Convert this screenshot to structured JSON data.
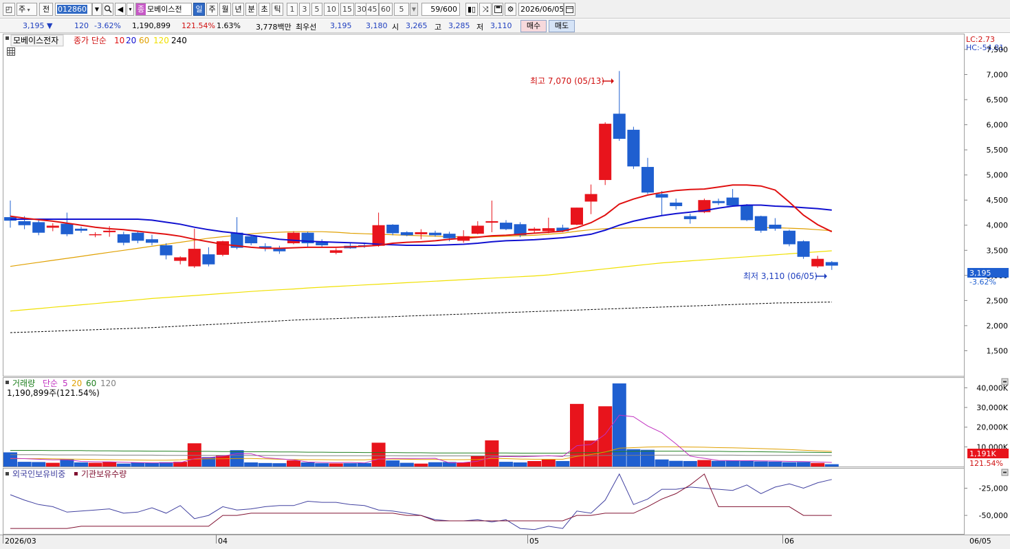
{
  "toolbar": {
    "type_label": "주",
    "type_all": "전",
    "stock_code": "012860",
    "stock_name": "모베이스전",
    "name_badge": "종",
    "periods": [
      "일",
      "주",
      "월",
      "년",
      "분",
      "초",
      "틱"
    ],
    "selected_period": "일",
    "intervals": [
      "1",
      "3",
      "5",
      "10",
      "15",
      "30",
      "45",
      "60"
    ],
    "custom_interval": "5",
    "count": "59/600",
    "date": "2026/06/05"
  },
  "quote": {
    "price": "3,195",
    "arrow": "▼",
    "change": "120",
    "change_pct": "-3.62%",
    "volume": "1,190,899",
    "volume_ratio": "121.54%",
    "turnover_pct": "1.63%",
    "amount": "3,778백만",
    "best_label": "최우선",
    "best_ask": "3,195",
    "best_bid": "3,180",
    "open_label": "시",
    "open": "3,265",
    "high_label": "고",
    "high": "3,285",
    "low_label": "저",
    "low": "3,110",
    "buy_label": "매수",
    "sell_label": "매도"
  },
  "price_panel": {
    "stock_tab": "모베이스전자",
    "ma_label": "종가 단순",
    "ma_periods": [
      {
        "label": "10",
        "color": "#e01010"
      },
      {
        "label": "20",
        "color": "#1010d0"
      },
      {
        "label": "60",
        "color": "#e0a000"
      },
      {
        "label": "120",
        "color": "#f0e000"
      },
      {
        "label": "240",
        "color": "#000000"
      }
    ],
    "lc": "LC:2.73",
    "hc": "HC:-54.81",
    "high_annotation": "최고 7,070 (05/13)",
    "low_annotation": "최저 3,110 (06/05)",
    "current_price_tag": "3,195",
    "current_pct_tag": "-3.62%",
    "up_color": "#e8141c",
    "down_color": "#1f5fd0"
  },
  "volume_panel": {
    "title": "거래량",
    "ma_label": "단순",
    "ma_periods": [
      {
        "label": "5",
        "color": "#c030c0"
      },
      {
        "label": "20",
        "color": "#e0a000"
      },
      {
        "label": "60",
        "color": "#208020"
      },
      {
        "label": "120",
        "color": "#808080"
      }
    ],
    "summary": "1,190,899주(121.54%)",
    "current_tag": "1,191K",
    "current_pct_tag": "121.54%"
  },
  "holding_panel": {
    "foreign_label": "외국인보유비중",
    "institution_label": "기관보유수량"
  },
  "x_axis": {
    "labels": [
      "2026/03",
      "04",
      "05",
      "06"
    ],
    "current_date_label": "06/05"
  },
  "chart_data": [
    {
      "type": "candlestick",
      "ylim": [
        1000,
        7800
      ],
      "y_ticks": [
        "7,500",
        "7,000",
        "6,500",
        "6,000",
        "5,500",
        "5,000",
        "4,500",
        "4,000",
        "3,500",
        "3,000",
        "2,500",
        "2,000",
        "1,500"
      ],
      "y_tick_values": [
        7500,
        7000,
        6500,
        6000,
        5500,
        5000,
        4500,
        4000,
        3500,
        3000,
        2500,
        2000,
        1500
      ],
      "candles": [
        [
          4160,
          4490,
          3950,
          4090
        ],
        [
          4080,
          4180,
          3920,
          4000
        ],
        [
          4060,
          4110,
          3800,
          3850
        ],
        [
          3950,
          4040,
          3880,
          3990
        ],
        [
          4030,
          4250,
          3780,
          3820
        ],
        [
          3930,
          3970,
          3850,
          3890
        ],
        [
          3800,
          3860,
          3760,
          3820
        ],
        [
          3860,
          3980,
          3770,
          3890
        ],
        [
          3820,
          3870,
          3600,
          3650
        ],
        [
          3850,
          3880,
          3640,
          3690
        ],
        [
          3720,
          3810,
          3600,
          3650
        ],
        [
          3600,
          3640,
          3320,
          3400
        ],
        [
          3290,
          3380,
          3220,
          3360
        ],
        [
          3180,
          3930,
          3150,
          3530
        ],
        [
          3420,
          3560,
          3180,
          3220
        ],
        [
          3410,
          3690,
          3380,
          3680
        ],
        [
          3850,
          4160,
          3520,
          3550
        ],
        [
          3780,
          3810,
          3600,
          3640
        ],
        [
          3580,
          3640,
          3480,
          3540
        ],
        [
          3550,
          3590,
          3430,
          3480
        ],
        [
          3640,
          3880,
          3620,
          3850
        ],
        [
          3850,
          3870,
          3560,
          3640
        ],
        [
          3660,
          3720,
          3560,
          3600
        ],
        [
          3450,
          3540,
          3420,
          3500
        ],
        [
          3590,
          3640,
          3530,
          3540
        ],
        [
          3600,
          3640,
          3550,
          3580
        ],
        [
          3590,
          4250,
          3570,
          4000
        ],
        [
          4010,
          4020,
          3800,
          3840
        ],
        [
          3860,
          3880,
          3780,
          3800
        ],
        [
          3820,
          3920,
          3720,
          3860
        ],
        [
          3850,
          3890,
          3770,
          3800
        ],
        [
          3830,
          3870,
          3680,
          3740
        ],
        [
          3690,
          3900,
          3650,
          3780
        ],
        [
          3830,
          4080,
          3820,
          3990
        ],
        [
          4050,
          4490,
          3860,
          4080
        ],
        [
          4050,
          4100,
          3900,
          3920
        ],
        [
          4020,
          4060,
          3760,
          3800
        ],
        [
          3890,
          3960,
          3840,
          3930
        ],
        [
          3880,
          4150,
          3840,
          3940
        ],
        [
          3950,
          4010,
          3860,
          3880
        ],
        [
          4010,
          4350,
          4000,
          4350
        ],
        [
          4470,
          4810,
          4220,
          4620
        ],
        [
          4900,
          6050,
          4800,
          6020
        ],
        [
          6220,
          7070,
          5680,
          5720
        ],
        [
          5900,
          5960,
          5120,
          5170
        ],
        [
          5160,
          5340,
          4620,
          4650
        ],
        [
          4620,
          4680,
          4200,
          4550
        ],
        [
          4450,
          4530,
          4310,
          4380
        ],
        [
          4180,
          4230,
          4030,
          4120
        ],
        [
          4260,
          4530,
          4240,
          4500
        ],
        [
          4480,
          4530,
          4400,
          4440
        ],
        [
          4550,
          4720,
          4380,
          4390
        ],
        [
          4390,
          4420,
          4080,
          4100
        ],
        [
          4180,
          4190,
          3850,
          3890
        ],
        [
          4010,
          4140,
          3890,
          3930
        ],
        [
          3890,
          3910,
          3580,
          3620
        ],
        [
          3680,
          3700,
          3330,
          3370
        ],
        [
          3180,
          3390,
          3150,
          3330
        ],
        [
          3265,
          3285,
          3110,
          3195
        ]
      ],
      "ma10": [
        4180,
        4140,
        4110,
        4080,
        4040,
        4000,
        3960,
        3930,
        3910,
        3880,
        3850,
        3820,
        3780,
        3720,
        3670,
        3620,
        3590,
        3560,
        3540,
        3540,
        3550,
        3560,
        3560,
        3560,
        3570,
        3580,
        3600,
        3640,
        3660,
        3670,
        3690,
        3720,
        3740,
        3760,
        3790,
        3800,
        3820,
        3840,
        3860,
        3880,
        3950,
        4050,
        4200,
        4420,
        4520,
        4600,
        4650,
        4690,
        4710,
        4720,
        4760,
        4800,
        4800,
        4780,
        4700,
        4460,
        4200,
        4010,
        3870
      ],
      "ma20": [
        4120,
        4120,
        4120,
        4120,
        4120,
        4120,
        4120,
        4120,
        4120,
        4120,
        4100,
        4060,
        4020,
        3960,
        3910,
        3870,
        3840,
        3800,
        3760,
        3720,
        3700,
        3680,
        3670,
        3660,
        3650,
        3640,
        3620,
        3610,
        3600,
        3600,
        3600,
        3610,
        3620,
        3640,
        3670,
        3690,
        3700,
        3710,
        3730,
        3750,
        3780,
        3820,
        3900,
        4000,
        4080,
        4140,
        4190,
        4230,
        4260,
        4290,
        4340,
        4380,
        4400,
        4400,
        4380,
        4370,
        4350,
        4330,
        4300
      ],
      "ma60": [
        3180,
        3220,
        3260,
        3300,
        3340,
        3380,
        3420,
        3460,
        3500,
        3540,
        3580,
        3620,
        3660,
        3700,
        3740,
        3770,
        3800,
        3830,
        3850,
        3860,
        3870,
        3870,
        3870,
        3860,
        3840,
        3830,
        3820,
        3810,
        3800,
        3790,
        3780,
        3770,
        3770,
        3770,
        3770,
        3780,
        3790,
        3800,
        3820,
        3840,
        3880,
        3910,
        3930,
        3940,
        3950,
        3950,
        3950,
        3950,
        3950,
        3950,
        3950,
        3950,
        3950,
        3950,
        3950,
        3940,
        3930,
        3910,
        3890
      ],
      "ma120": [
        2290,
        2315,
        2340,
        2365,
        2390,
        2415,
        2440,
        2465,
        2490,
        2515,
        2540,
        2560,
        2580,
        2600,
        2620,
        2640,
        2660,
        2680,
        2700,
        2715,
        2730,
        2750,
        2765,
        2780,
        2795,
        2810,
        2825,
        2840,
        2855,
        2870,
        2885,
        2900,
        2915,
        2930,
        2945,
        2960,
        2975,
        2990,
        3010,
        3040,
        3070,
        3100,
        3130,
        3160,
        3190,
        3220,
        3250,
        3270,
        3290,
        3310,
        3330,
        3350,
        3370,
        3390,
        3410,
        3430,
        3450,
        3470,
        3490
      ],
      "ma240": [
        1860,
        1870,
        1880,
        1890,
        1900,
        1910,
        1920,
        1930,
        1940,
        1950,
        1960,
        1975,
        1990,
        2005,
        2020,
        2035,
        2050,
        2065,
        2080,
        2095,
        2110,
        2120,
        2130,
        2140,
        2150,
        2160,
        2170,
        2180,
        2190,
        2200,
        2210,
        2220,
        2230,
        2240,
        2250,
        2260,
        2270,
        2280,
        2290,
        2300,
        2310,
        2320,
        2330,
        2340,
        2350,
        2360,
        2370,
        2380,
        2390,
        2400,
        2410,
        2420,
        2430,
        2440,
        2450,
        2455,
        2460,
        2465,
        2470
      ]
    },
    {
      "type": "bar",
      "series_name": "거래량",
      "ylim": [
        0,
        45000
      ],
      "y_ticks": [
        "40,000K",
        "30,000K",
        "20,000K",
        "10,000K"
      ],
      "y_tick_values": [
        40000,
        30000,
        20000,
        10000
      ],
      "volumes": [
        7200,
        2400,
        2300,
        1900,
        3700,
        2100,
        1900,
        2300,
        1500,
        2100,
        1900,
        2200,
        2400,
        11800,
        4800,
        5600,
        8300,
        2100,
        1800,
        1700,
        3100,
        2100,
        1700,
        1600,
        1700,
        1800,
        12100,
        3100,
        1900,
        1500,
        2200,
        2300,
        2100,
        5500,
        13300,
        2400,
        2100,
        2800,
        3600,
        2800,
        31800,
        13200,
        30600,
        42200,
        8800,
        8500,
        3600,
        2900,
        2800,
        3300,
        2900,
        3100,
        2800,
        2600,
        2500,
        2200,
        2300,
        1800,
        1191
      ],
      "vma5": [
        4200,
        4000,
        3700,
        3400,
        3500,
        2600,
        2400,
        2400,
        2200,
        2000,
        1900,
        1900,
        2000,
        4000,
        4500,
        5300,
        6500,
        6500,
        4500,
        3900,
        3400,
        2300,
        2100,
        2000,
        2100,
        1800,
        3800,
        4100,
        4100,
        4100,
        4200,
        1900,
        2000,
        2700,
        4800,
        5100,
        5000,
        5200,
        5500,
        5100,
        10600,
        11200,
        16400,
        26100,
        25300,
        20600,
        17200,
        11500,
        5300,
        4200,
        3100,
        3000,
        3000,
        2900,
        2800,
        2600,
        2500,
        2300,
        2100
      ],
      "vma20": [
        4000,
        4000,
        4000,
        3900,
        3800,
        3700,
        3600,
        3500,
        3400,
        3300,
        3200,
        3200,
        3400,
        3800,
        3900,
        3900,
        4100,
        4100,
        3900,
        3700,
        3600,
        3500,
        3500,
        3400,
        3400,
        3400,
        3800,
        3800,
        3700,
        3600,
        3600,
        3500,
        3500,
        3600,
        4100,
        4000,
        3800,
        3700,
        3700,
        3700,
        5200,
        6100,
        7400,
        9300,
        9600,
        9900,
        10000,
        10000,
        9900,
        9800,
        9600,
        9500,
        9300,
        9100,
        8900,
        8600,
        8300,
        8000,
        7700
      ],
      "vma60": [
        8200,
        8200,
        8200,
        8100,
        8100,
        8100,
        8000,
        8000,
        7900,
        7900,
        7800,
        7800,
        7700,
        7700,
        7700,
        7600,
        7600,
        7500,
        7500,
        7400,
        7400,
        7300,
        7300,
        7200,
        7200,
        7100,
        7100,
        7100,
        7000,
        7000,
        6900,
        6900,
        6900,
        6900,
        6900,
        6900,
        6800,
        6800,
        6800,
        6800,
        7000,
        7100,
        7300,
        7600,
        7700,
        7800,
        7800,
        7800,
        7800,
        7700,
        7700,
        7600,
        7600,
        7500,
        7400,
        7300,
        7300,
        7200,
        7100
      ],
      "vma120": [
        6000,
        6000,
        6000,
        5900,
        5900,
        5900,
        5900,
        5800,
        5800,
        5800,
        5800,
        5700,
        5700,
        5700,
        5700,
        5700,
        5600,
        5600,
        5600,
        5600,
        5600,
        5500,
        5500,
        5500,
        5500,
        5500,
        5500,
        5500,
        5400,
        5400,
        5400,
        5400,
        5400,
        5400,
        5400,
        5400,
        5400,
        5400,
        5400,
        5400,
        5500,
        5500,
        5600,
        5700,
        5700,
        5800,
        5800,
        5800,
        5800,
        5800,
        5800,
        5800,
        5700,
        5700,
        5700,
        5700,
        5700,
        5600,
        5600
      ]
    },
    {
      "type": "line",
      "ylim": [
        -67000,
        -7000
      ],
      "y_ticks": [
        "-25,000",
        "-50,000"
      ],
      "y_tick_values": [
        -25000,
        -50000
      ],
      "series": [
        {
          "name": "외국인보유비중",
          "color": "#4040a0",
          "values": [
            -31000,
            -36000,
            -40000,
            -42000,
            -47000,
            -46000,
            -45000,
            -44000,
            -48000,
            -47000,
            -43000,
            -48000,
            -41000,
            -53000,
            -50000,
            -42000,
            -45000,
            -44000,
            -42000,
            -41000,
            -41000,
            -37000,
            -38000,
            -38000,
            -40000,
            -41000,
            -45000,
            -46000,
            -48000,
            -50000,
            -54000,
            -55000,
            -55000,
            -54000,
            -56000,
            -54000,
            -62000,
            -63000,
            -60000,
            -62000,
            -46000,
            -48000,
            -36000,
            -12000,
            -40000,
            -35000,
            -26000,
            -26000,
            -24000,
            -25000,
            -26000,
            -27000,
            -22000,
            -30000,
            -24000,
            -21000,
            -25000,
            -20000,
            -17000
          ]
        },
        {
          "name": "기관보유수량",
          "color": "#801030",
          "values": [
            -62000,
            -62000,
            -62000,
            -62000,
            -62000,
            -60000,
            -60000,
            -60000,
            -60000,
            -60000,
            -60000,
            -60000,
            -60000,
            -60000,
            -60000,
            -50000,
            -50000,
            -48000,
            -48000,
            -48000,
            -48000,
            -48000,
            -48000,
            -48000,
            -48000,
            -48000,
            -48000,
            -48000,
            -50000,
            -50000,
            -55000,
            -55000,
            -55000,
            -55000,
            -55000,
            -55000,
            -55000,
            -55000,
            -55000,
            -55000,
            -50000,
            -50000,
            -48000,
            -48000,
            -48000,
            -42000,
            -35000,
            -30000,
            -22000,
            -12000,
            -42000,
            -42000,
            -42000,
            -42000,
            -42000,
            -42000,
            -50000,
            -50000,
            -50000
          ]
        }
      ]
    }
  ]
}
